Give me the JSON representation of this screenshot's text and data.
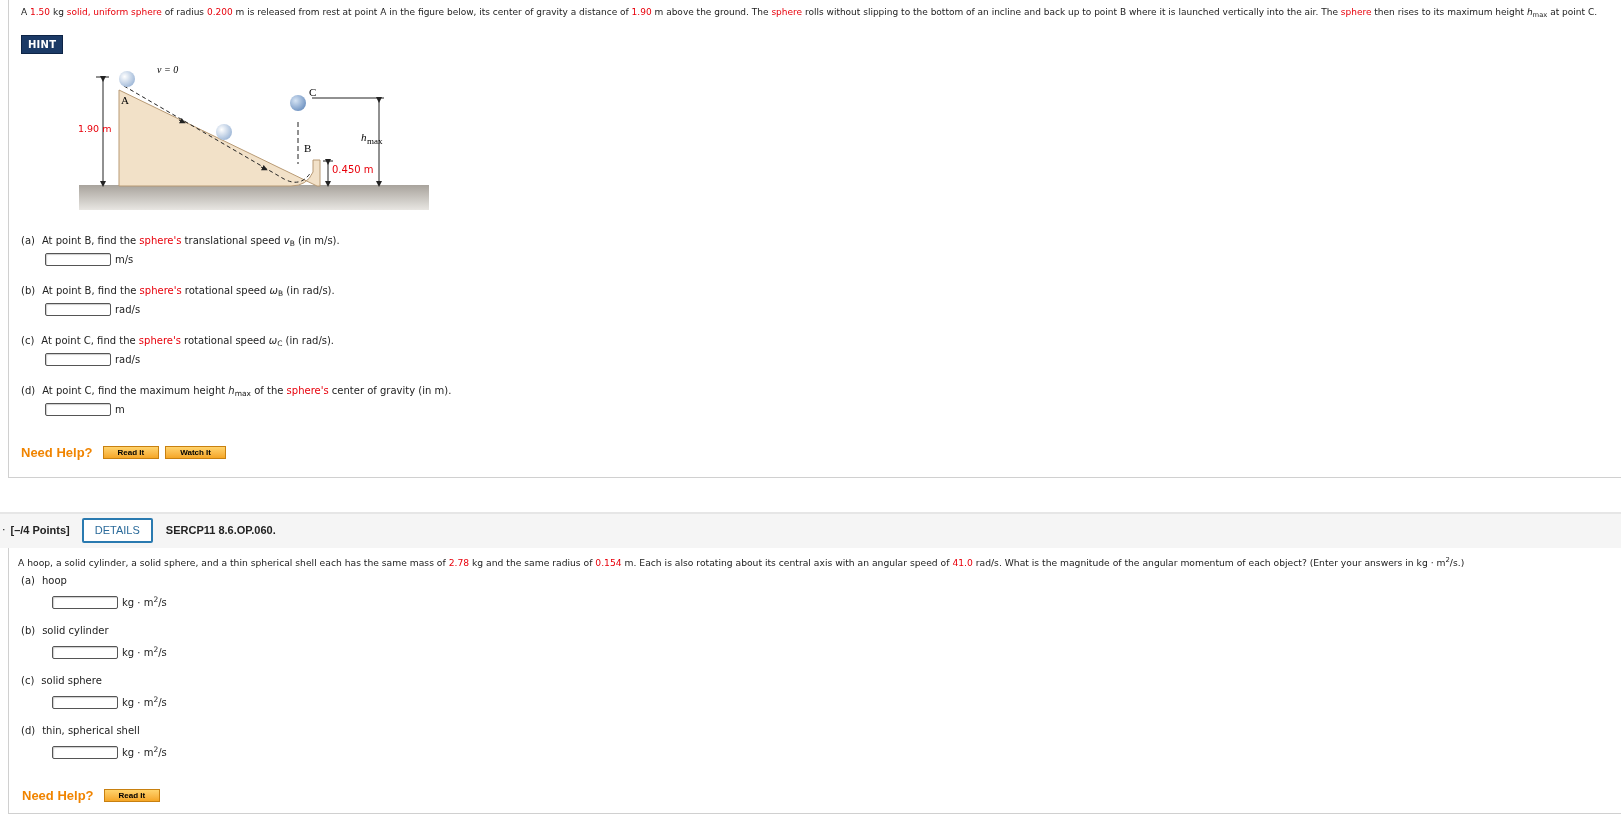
{
  "question_1": {
    "intro": [
      {
        "text": "A ",
        "highlighted": false
      },
      {
        "text": "1.50",
        "highlighted": true
      },
      {
        "text": " kg ",
        "highlighted": false
      },
      {
        "text": "solid, uniform sphere",
        "highlighted": true
      },
      {
        "text": " of radius ",
        "highlighted": false
      },
      {
        "text": "0.200",
        "highlighted": true
      },
      {
        "text": " m is released from rest at point A in the figure below, its center of gravity a distance of ",
        "highlighted": false
      },
      {
        "text": "1.90",
        "highlighted": true
      },
      {
        "text": " m above the ground. The ",
        "highlighted": false
      },
      {
        "text": "sphere",
        "highlighted": true
      },
      {
        "text": " rolls without slipping to the bottom of an incline and back up to point B where it is launched vertically into the air. The ",
        "highlighted": false
      },
      {
        "text": "sphere",
        "highlighted": true
      },
      {
        "text": " then rises to its maximum height *h*$_{max}$ at point C.",
        "highlighted": false
      }
    ],
    "hint_button": "HINT",
    "figure": {
      "v_label": "v = 0",
      "a_label": "A",
      "c_label": "C",
      "b_label": "B",
      "height_label": "1.90 m",
      "hmax_label": "h",
      "hmax_sub": "max",
      "lip_label": "0.450 m"
    },
    "parts": [
      {
        "letter": "(a)",
        "segments": [
          {
            "text": "At point B, find the ",
            "highlighted": false
          },
          {
            "text": "sphere's",
            "highlighted": true
          },
          {
            "text": " translational speed *v*$_{B}$ (in m/s).",
            "highlighted": false
          }
        ],
        "unit": "m/s"
      },
      {
        "letter": "(b)",
        "segments": [
          {
            "text": "At point B, find the ",
            "highlighted": false
          },
          {
            "text": "sphere's",
            "highlighted": true
          },
          {
            "text": " rotational speed *ω*$_{B}$ (in rad/s).",
            "highlighted": false
          }
        ],
        "unit": "rad/s"
      },
      {
        "letter": "(c)",
        "segments": [
          {
            "text": "At point C, find the ",
            "highlighted": false
          },
          {
            "text": "sphere's",
            "highlighted": true
          },
          {
            "text": " rotational speed *ω*$_{C}$ (in rad/s).",
            "highlighted": false
          }
        ],
        "unit": "rad/s"
      },
      {
        "letter": "(d)",
        "segments": [
          {
            "text": "At point C, find the maximum height *h*$_{max}$ of the ",
            "highlighted": false
          },
          {
            "text": "sphere's",
            "highlighted": true
          },
          {
            "text": " center of gravity (in m).",
            "highlighted": false
          }
        ],
        "unit": "m"
      }
    ],
    "need_help": "Need Help?",
    "help_buttons": [
      "Read It",
      "Watch It"
    ]
  },
  "question_2": {
    "marker": "·",
    "points": "[–/4 Points]",
    "details_button": "DETAILS",
    "code": "SERCP11 8.6.OP.060.",
    "intro": [
      {
        "text": "A hoop, a solid cylinder, a solid sphere, and a thin spherical shell each has the same mass of ",
        "highlighted": false
      },
      {
        "text": "2.78",
        "highlighted": true
      },
      {
        "text": " kg and the same radius of ",
        "highlighted": false
      },
      {
        "text": "0.154",
        "highlighted": true
      },
      {
        "text": " m. Each is also rotating about its central axis with an angular speed of ",
        "highlighted": false
      },
      {
        "text": "41.0",
        "highlighted": true
      },
      {
        "text": " rad/s. What is the magnitude of the angular momentum of each object? (Enter your answers in kg · m$^{2}$/s.)",
        "highlighted": false
      }
    ],
    "parts": [
      {
        "letter": "(a)",
        "label": "hoop",
        "unit": "kg · m$^{2}$/s"
      },
      {
        "letter": "(b)",
        "label": "solid cylinder",
        "unit": "kg · m$^{2}$/s"
      },
      {
        "letter": "(c)",
        "label": "solid sphere",
        "unit": "kg · m$^{2}$/s"
      },
      {
        "letter": "(d)",
        "label": "thin, spherical shell",
        "unit": "kg · m$^{2}$/s"
      }
    ],
    "need_help": "Need Help?",
    "help_buttons": [
      "Read It"
    ]
  }
}
